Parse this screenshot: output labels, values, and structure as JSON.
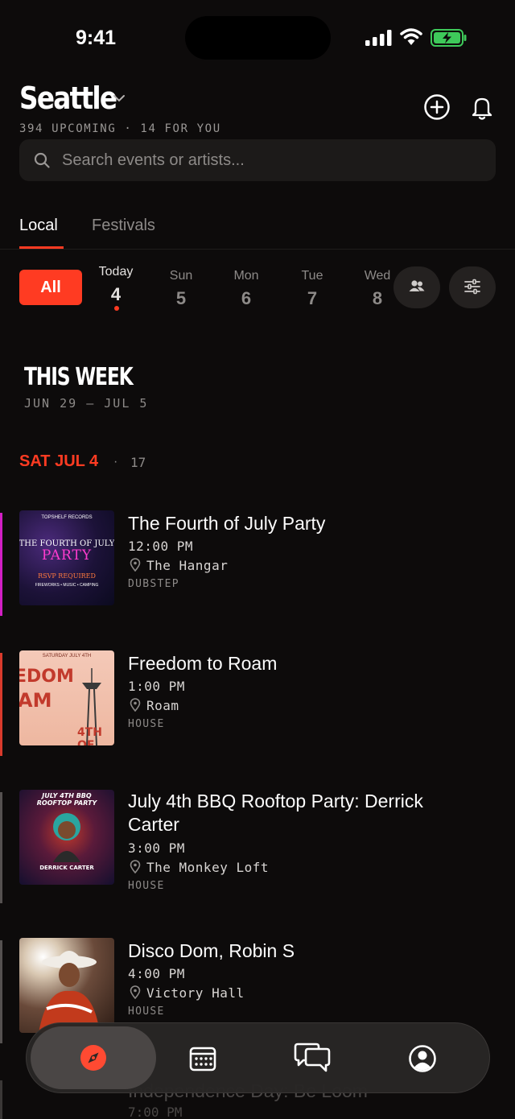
{
  "status_bar": {
    "time": "9:41"
  },
  "header": {
    "city": "Seattle",
    "subtitle": "394 UPCOMING · 14 FOR YOU",
    "add_icon": "plus-circle-icon",
    "notifications_icon": "bell-icon"
  },
  "search": {
    "placeholder": "Search events or artists..."
  },
  "tabs": [
    {
      "label": "Local",
      "active": true
    },
    {
      "label": "Festivals",
      "active": false
    }
  ],
  "day_filter": {
    "all_label": "All",
    "days": [
      {
        "name": "Today",
        "date": "4",
        "selected": true
      },
      {
        "name": "Sun",
        "date": "5"
      },
      {
        "name": "Mon",
        "date": "6"
      },
      {
        "name": "Tue",
        "date": "7"
      },
      {
        "name": "Wed",
        "date": "8"
      }
    ],
    "friends_icon": "people-icon",
    "filter_icon": "sliders-icon"
  },
  "section": {
    "title": "THIS WEEK",
    "range": "JUN 29 – JUL 5",
    "date_header": "SAT JUL 4",
    "separator": "·",
    "count": "17"
  },
  "events": [
    {
      "title": "The Fourth of July Party",
      "time": "12:00 PM",
      "venue": "The Hangar",
      "genre": "DUBSTEP",
      "accent": "#d21fc4",
      "poster": {
        "top": "TOPSHELF RECORDS",
        "mid": "THE FOURTH OF JULY",
        "big": "PARTY",
        "sub": "RSVP REQUIRED",
        "foot": "FIREWORKS • MUSIC • CAMPING"
      }
    },
    {
      "title": "Freedom to Roam",
      "time": "1:00 PM",
      "venue": "Roam",
      "genre": "HOUSE",
      "accent": "#d93a2c",
      "poster": {
        "top": "SATURDAY JULY 4TH",
        "big": "EDOM",
        "mid": "AM",
        "sub": "4TH OF"
      }
    },
    {
      "title": "July 4th BBQ Rooftop Party: Derrick Carter",
      "time": "3:00 PM",
      "venue": "The Monkey Loft",
      "genre": "HOUSE",
      "accent": "#555150",
      "poster": {
        "top": "JULY 4TH BBQ",
        "mid": "ROOFTOP PARTY",
        "big": "DERRICK CARTER"
      }
    },
    {
      "title": "Disco Dom, Robin S",
      "time": "4:00 PM",
      "venue": "Victory Hall",
      "genre": "HOUSE",
      "accent": "#555150"
    }
  ],
  "peek_event": {
    "title": "Independence Day: Be Loom",
    "time": "7:00 PM"
  },
  "bottom_nav": [
    {
      "icon": "compass-icon",
      "active": true
    },
    {
      "icon": "calendar-icon"
    },
    {
      "icon": "chat-icon"
    },
    {
      "icon": "profile-icon"
    }
  ],
  "colors": {
    "accent": "#ff3b22",
    "background": "#0d0b0b"
  }
}
